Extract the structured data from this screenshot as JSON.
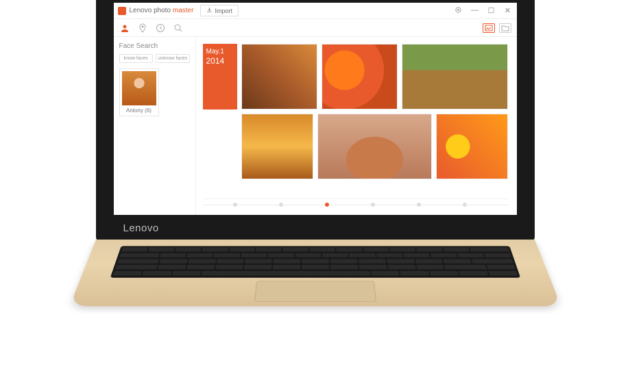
{
  "app": {
    "title_prefix": "Lenovo photo ",
    "title_accent": "master",
    "import_label": "Import"
  },
  "sidebar": {
    "title": "Face Search",
    "chip_known": "know faces",
    "chip_unknown": "unknow faces",
    "face_name": "Antony",
    "face_count": "(6)"
  },
  "gallery": {
    "date_label": "May.1",
    "date_year": "2014"
  },
  "laptop_brand": "Lenovo",
  "accent_color": "#e85a2c"
}
